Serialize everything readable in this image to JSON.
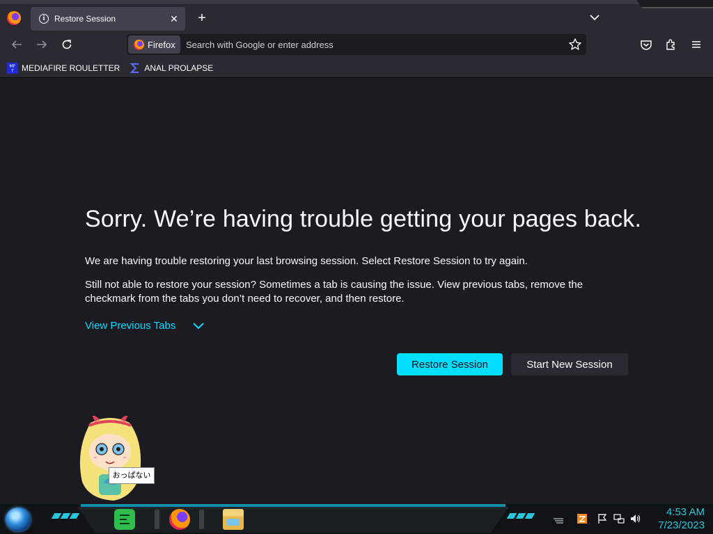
{
  "tab": {
    "title": "Restore Session"
  },
  "toolbar": {
    "identity_label": "Firefox",
    "url_placeholder": "Search with Google or enter address"
  },
  "bookmarks": [
    {
      "label": "MEDIAFIRE ROULETTER",
      "icon": "mediafire-favicon"
    },
    {
      "label": "ANAL PROLAPSE",
      "icon": "sigma-favicon"
    }
  ],
  "page": {
    "title": "Sorry. We’re having trouble getting your pages back.",
    "paragraph1": "We are having trouble restoring your last browsing session. Select Restore Session to try again.",
    "paragraph2": "Still not able to restore your session? Sometimes a tab is causing the issue. View previous tabs, remove the checkmark from the tabs you don’t need to recover, and then restore.",
    "view_previous_tabs": "View Previous Tabs",
    "restore_button": "Restore Session",
    "new_session_button": "Start New Session"
  },
  "desktop": {
    "mascot_tooltip": "おっぱない"
  },
  "taskbar": {
    "apps": [
      "notes-app",
      "firefox-app",
      "file-explorer-app"
    ],
    "clock_time": "4:53 AM",
    "clock_date": "7/23/2023"
  },
  "colors": {
    "accent": "#00ddff",
    "background": "#1c1b22",
    "toolbar": "#2b2a33",
    "taskbar_accent": "#29c6dc"
  }
}
